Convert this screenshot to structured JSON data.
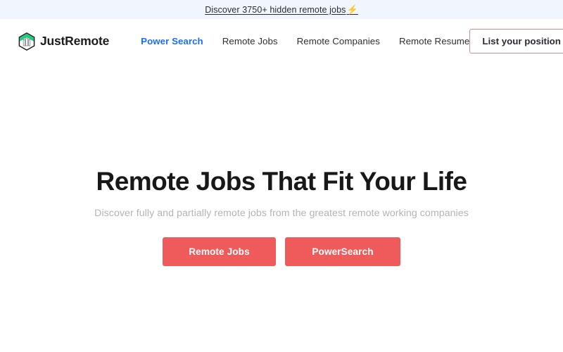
{
  "promo": {
    "text": "Discover 3750+ hidden remote jobs",
    "bolt": "⚡",
    "background_color": "#F1F5FD"
  },
  "header": {
    "brand": {
      "name": "JustRemote",
      "logo_icon": "hexagon-building-logo",
      "logo_color": "#22C97F"
    },
    "nav": [
      {
        "label": "Power Search",
        "active": true
      },
      {
        "label": "Remote Jobs",
        "active": false
      },
      {
        "label": "Remote Companies",
        "active": false
      },
      {
        "label": "Remote Resume",
        "active": false
      }
    ],
    "active_color": "#1A6DFF",
    "list_position_label": "List your position",
    "list_position_border_color": "#E98585",
    "favorites_icon": "heart-icon",
    "favorites_glyph": "♥"
  },
  "hero": {
    "title": "Remote Jobs That Fit Your Life",
    "subtitle": "Discover fully and partially remote jobs from the greatest remote working companies",
    "buttons": [
      {
        "label": "Remote Jobs"
      },
      {
        "label": "PowerSearch"
      }
    ],
    "accent_color": "#EF5B5B",
    "subtitle_color": "#B4B4B8"
  }
}
